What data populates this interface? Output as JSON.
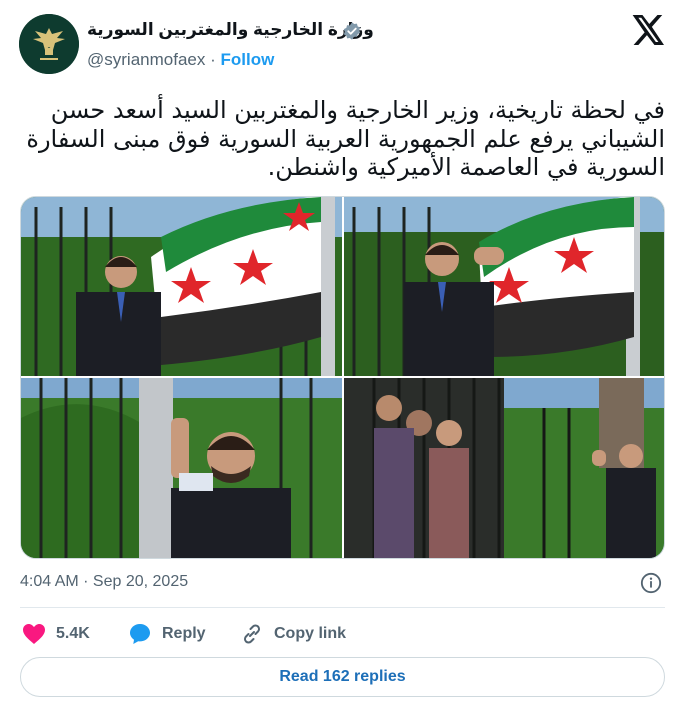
{
  "account": {
    "name": "وزارة الخارجية والمغتربين السورية",
    "handle": "@syrianmofaex",
    "separator": "·",
    "follow_label": "Follow",
    "verified": true
  },
  "tweet": {
    "text": "في لحظة تاريخية، وزير الخارجية والمغتربين السيد أسعد حسن الشيباني يرفع علم الجمهورية العربية السورية فوق مبنى السفارة السورية في العاصمة الأميركية واشنطن.",
    "timestamp": "4:04 AM · Sep 20, 2025",
    "photos": [
      {
        "subject": "man in suit beside flag at fence"
      },
      {
        "subject": "man raising flag on pole"
      },
      {
        "subject": "man holding flag pole"
      },
      {
        "subject": "crowd at fence, man clapping"
      }
    ]
  },
  "actions": {
    "like_count": "5.4K",
    "reply_label": "Reply",
    "copy_link_label": "Copy link",
    "read_replies_label": "Read 162 replies"
  },
  "colors": {
    "accent": "#1d9bf0",
    "like": "#f91880",
    "text_secondary": "#536471",
    "flag_green": "#1f8a3b",
    "flag_red": "#e0262b",
    "verified_badge": "#829aab"
  },
  "icons": {
    "verified": "verified-badge-icon",
    "logo": "x-logo-icon",
    "info": "info-icon",
    "like": "heart-icon",
    "reply": "speech-bubble-icon",
    "copy": "link-icon"
  }
}
